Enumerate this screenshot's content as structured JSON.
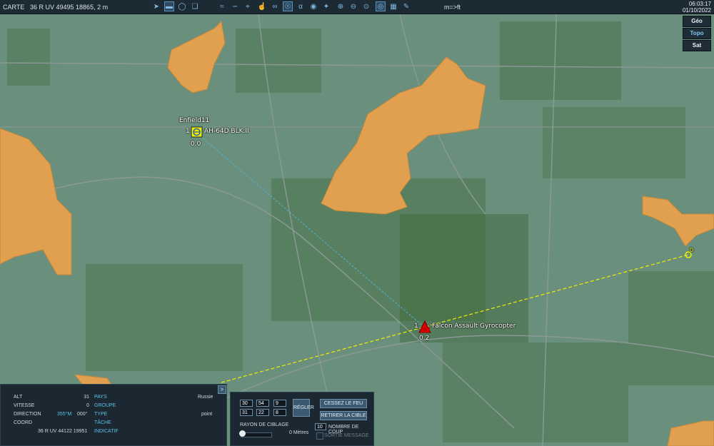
{
  "topbar": {
    "title": "CARTE",
    "coords": "36 R UV 49495 18865, 2 m",
    "units": "m=>ft",
    "time": "06:03:17",
    "date": "01/10/2022",
    "icons": [
      "cursor-icon",
      "ruler-icon",
      "circle-icon",
      "layers-icon",
      "signal-icon",
      "route-icon",
      "target-icon",
      "wifi-icon",
      "lasso-icon",
      "radar-icon",
      "alpha-icon",
      "eye-icon",
      "zoom-in-icon",
      "zoom-out-icon",
      "zoom-fit-icon",
      "radar-sweep-icon",
      "grid-icon",
      "pencil-icon"
    ]
  },
  "map_types": [
    "Géo",
    "Topo",
    "Sat"
  ],
  "units_on_map": {
    "heli": {
      "group": "Enfield11",
      "count": "1",
      "name": "AH-64D BLK.II",
      "value": "0.0"
    },
    "target": {
      "count": "1",
      "name": "Falcon Assault Gyrocopter",
      "value": "0.2"
    },
    "waypoint": {
      "label": "0"
    }
  },
  "info": {
    "alt_label": "ALT",
    "alt": "31",
    "speed_label": "VITESSE",
    "speed": "0",
    "dir_label": "DIRECTION",
    "dir_mag": "355°M",
    "dir_true": "000°",
    "coord_label": "COORD",
    "coord": "36 R UV 44122 19951",
    "pays_label": "PAYS",
    "pays": "Russie",
    "groupe_label": "GROUPE",
    "type_label": "TYPE",
    "type": "point",
    "tache_label": "TÂCHE",
    "indicatif_label": "INDICATIF",
    "expand": ">"
  },
  "fire": {
    "lat": [
      "30",
      "54",
      "9"
    ],
    "lon": [
      "31",
      "22",
      "8"
    ],
    "set_label": "RÉGLER",
    "cease_label": "CESSEZ LE FEU",
    "remove_label": "RETIRER LA CIBLE",
    "radius_label": "RAYON DE CIBLAGE",
    "radius_value": "0 Mètres",
    "shots_value": "10",
    "shots_label": "NOMBRE DE COUP",
    "message_label": "SORTIE MESSAGE"
  },
  "colors": {
    "map": "#6a8f7c",
    "town": "#e0a050",
    "forest": "#2f5a1e",
    "road": "#8a9896",
    "panel": "#1b2731",
    "accent": "#5fc1e8",
    "route": "#f0f000"
  }
}
